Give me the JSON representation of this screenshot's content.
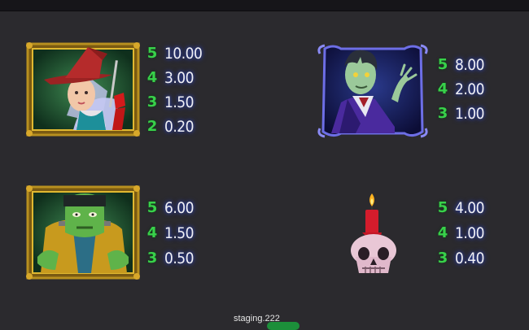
{
  "colors": {
    "background": "#2b2a2e",
    "multiplier_green": "#38d14a",
    "payout_glow": "#2b3fa8"
  },
  "symbols": [
    {
      "name": "witch",
      "icon": "witch-icon",
      "rows": [
        {
          "count": "5",
          "payout": "10.00"
        },
        {
          "count": "4",
          "payout": "3.00"
        },
        {
          "count": "3",
          "payout": "1.50"
        },
        {
          "count": "2",
          "payout": "0.20"
        }
      ]
    },
    {
      "name": "vampire",
      "icon": "vampire-icon",
      "rows": [
        {
          "count": "5",
          "payout": "8.00"
        },
        {
          "count": "4",
          "payout": "2.00"
        },
        {
          "count": "3",
          "payout": "1.00"
        }
      ]
    },
    {
      "name": "frankenstein",
      "icon": "frankenstein-icon",
      "rows": [
        {
          "count": "5",
          "payout": "6.00"
        },
        {
          "count": "4",
          "payout": "1.50"
        },
        {
          "count": "3",
          "payout": "0.50"
        }
      ]
    },
    {
      "name": "skull-candle",
      "icon": "skull-candle-icon",
      "rows": [
        {
          "count": "5",
          "payout": "4.00"
        },
        {
          "count": "4",
          "payout": "1.00"
        },
        {
          "count": "3",
          "payout": "0.40"
        }
      ]
    }
  ],
  "footer": {
    "build_label": "staging.222"
  }
}
